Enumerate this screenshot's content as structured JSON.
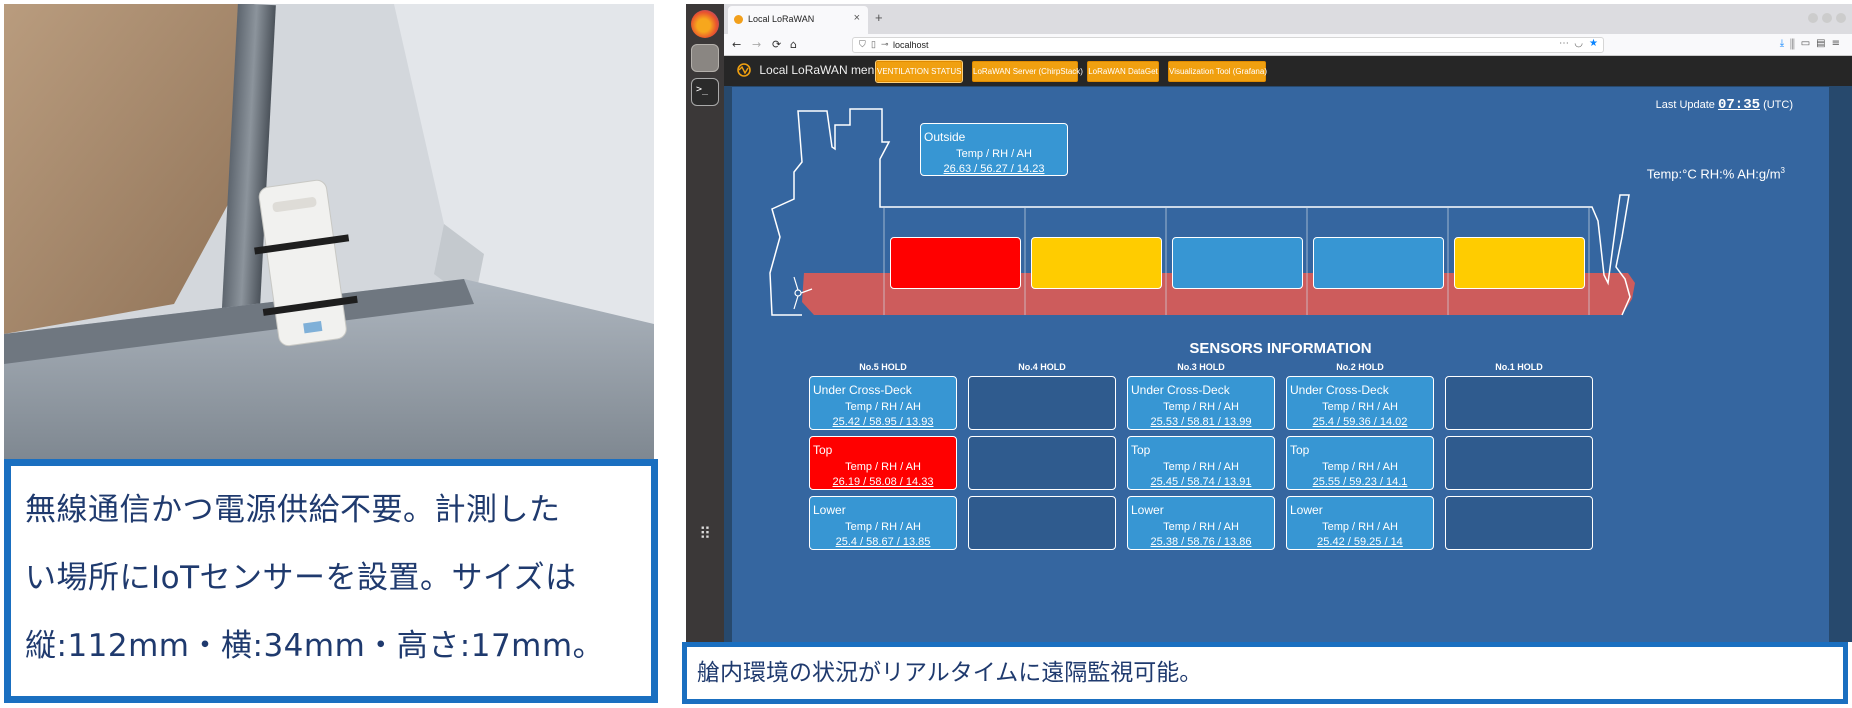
{
  "left_caption": {
    "lines": [
      "無線通信かつ電源供給不要。計測した",
      "い場所にIoTセンサーを設置。サイズは",
      "縦:112mm・横:34mm・高さ:17mm。"
    ]
  },
  "right_caption": "艙内環境の状況がリアルタイムに遠隔監視可能。",
  "browser": {
    "tab_title": "Local LoRaWAN",
    "tab_close": "×",
    "new_tab": "+",
    "url": "localhost"
  },
  "app": {
    "brand": "Local LoRaWAN menu",
    "nav": [
      "VENTILATION STATUS",
      "LoRaWAN Server (ChirpStack)",
      "LoRaWAN DataGet",
      "Visualization Tool (Grafana)"
    ],
    "last_update_label": "Last Update",
    "last_update_time": "07:35",
    "last_update_tz": "(UTC)",
    "units": "Temp:°C RH:% AH:g/m",
    "units_sup": "3",
    "outside": {
      "title": "Outside",
      "header": "Temp / RH / AH",
      "values": "26.63 / 56.27 / 14.23"
    },
    "hold_colors": [
      "#ff0000",
      "#ffcc00",
      "#3796d3",
      "#3796d3",
      "#ffcc00"
    ],
    "hull_color": "#cd5c5c",
    "sensors_title": "SENSORS INFORMATION",
    "holds": [
      {
        "name": "No.5 HOLD",
        "cards": [
          {
            "title": "Under Cross-Deck",
            "header": "Temp / RH / AH",
            "values": "25.42 / 58.95 / 13.93",
            "color": "#3796d3"
          },
          {
            "title": "Top",
            "header": "Temp / RH / AH",
            "values": "26.19 / 58.08 / 14.33",
            "color": "#ff0000"
          },
          {
            "title": "Lower",
            "header": "Temp / RH / AH",
            "values": "25.4 / 58.67 / 13.85",
            "color": "#3796d3"
          }
        ]
      },
      {
        "name": "No.4 HOLD",
        "cards": [
          {
            "title": "",
            "header": "",
            "values": "",
            "color": ""
          },
          {
            "title": "",
            "header": "",
            "values": "",
            "color": ""
          },
          {
            "title": "",
            "header": "",
            "values": "",
            "color": ""
          }
        ]
      },
      {
        "name": "No.3 HOLD",
        "cards": [
          {
            "title": "Under Cross-Deck",
            "header": "Temp / RH / AH",
            "values": "25.53 / 58.81 / 13.99",
            "color": "#3796d3"
          },
          {
            "title": "Top",
            "header": "Temp / RH / AH",
            "values": "25.45 / 58.74 / 13.91",
            "color": "#3796d3"
          },
          {
            "title": "Lower",
            "header": "Temp / RH / AH",
            "values": "25.38 / 58.76 / 13.86",
            "color": "#3796d3"
          }
        ]
      },
      {
        "name": "No.2 HOLD",
        "cards": [
          {
            "title": "Under Cross-Deck",
            "header": "Temp / RH / AH",
            "values": "25.4 / 59.36 / 14.02",
            "color": "#3796d3"
          },
          {
            "title": "Top",
            "header": "Temp / RH / AH",
            "values": "25.55 / 59.23 / 14.1",
            "color": "#3796d3"
          },
          {
            "title": "Lower",
            "header": "Temp / RH / AH",
            "values": "25.42 / 59.25 / 14",
            "color": "#3796d3"
          }
        ]
      },
      {
        "name": "No.1 HOLD",
        "cards": [
          {
            "title": "",
            "header": "",
            "values": "",
            "color": ""
          },
          {
            "title": "",
            "header": "",
            "values": "",
            "color": ""
          },
          {
            "title": "",
            "header": "",
            "values": "",
            "color": ""
          }
        ]
      }
    ]
  }
}
